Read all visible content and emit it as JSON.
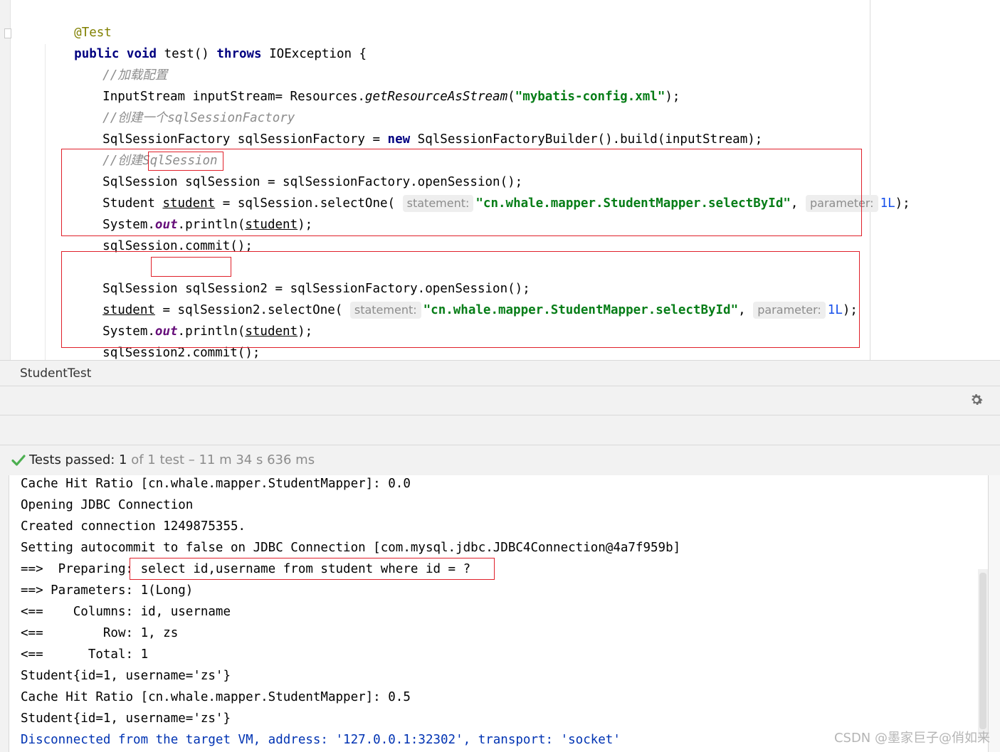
{
  "editor": {
    "annotation": "@Test",
    "method_sig": {
      "kw1": "public",
      "kw2": "void",
      "name": " test() ",
      "kw3": "throws",
      "rest": " IOException {"
    },
    "comment_load": "//加载配置",
    "line_input": {
      "pre": "InputStream inputStream= Resources.",
      "method": "getResourceAsStream",
      "open": "(",
      "str": "\"mybatis-config.xml\"",
      "close": ");"
    },
    "comment_factory": "//创建一个sqlSessionFactory",
    "line_factory": {
      "pre": "SqlSessionFactory sqlSessionFactory = ",
      "kw": "new",
      "rest": " SqlSessionFactoryBuilder().build(inputStream);"
    },
    "comment_session": "//创建SqlSession",
    "block1": {
      "l1_pre": "SqlSession ",
      "l1_var": "sqlSession",
      "l1_rest": " = sqlSessionFactory.openSession();",
      "l2_pre": "Student ",
      "l2_var": "student",
      "l2_mid": " = sqlSession.selectOne( ",
      "hint_statement": "statement:",
      "l2_str": "\"cn.whale.mapper.StudentMapper.selectById\"",
      "l2_comma": ", ",
      "hint_parameter": "parameter:",
      "l2_num": "1L",
      "l2_end": ");",
      "l3_pre": "System.",
      "l3_field": "out",
      "l3_mid": ".println(",
      "l3_var": "student",
      "l3_end": ");",
      "l4": "sqlSession.commit();"
    },
    "block2": {
      "l1_pre": "SqlSession ",
      "l1_var": "sqlSession2",
      "l1_rest": " = sqlSessionFactory.openSession();",
      "l2_var": "student",
      "l2_mid": " = sqlSession2.selectOne( ",
      "hint_statement": "statement:",
      "l2_str": "\"cn.whale.mapper.StudentMapper.selectById\"",
      "l2_comma": ", ",
      "hint_parameter": "parameter:",
      "l2_num": "1L",
      "l2_end": ");",
      "l3_pre": "System.",
      "l3_field": "out",
      "l3_mid": ".println(",
      "l3_var": "student",
      "l3_end": ");",
      "l4": "sqlSession2.commit();"
    }
  },
  "panel": {
    "title": "StudentTest"
  },
  "status": {
    "passed_label": "Tests passed: ",
    "passed_count": "1",
    "rest": " of 1 test – 11 m 34 s 636 ms"
  },
  "console": {
    "lines": [
      "Cache Hit Ratio [cn.whale.mapper.StudentMapper]: 0.0",
      "Opening JDBC Connection",
      "Created connection 1249875355.",
      "Setting autocommit to false on JDBC Connection [com.mysql.jdbc.JDBC4Connection@4a7f959b]",
      "==>  Preparing: select id,username from student where id = ? ",
      "==> Parameters: 1(Long)",
      "<==    Columns: id, username",
      "<==        Row: 1, zs",
      "<==      Total: 1",
      "Student{id=1, username='zs'}",
      "Cache Hit Ratio [cn.whale.mapper.StudentMapper]: 0.5",
      "Student{id=1, username='zs'}",
      "Disconnected from the target VM, address: '127.0.0.1:32302', transport: 'socket'"
    ]
  },
  "watermark": "CSDN @墨家巨子@俏如来",
  "colors": {
    "highlight_box": "#e0202a",
    "keyword": "#000080",
    "string": "#067d17",
    "pass_check": "#4caf50"
  }
}
